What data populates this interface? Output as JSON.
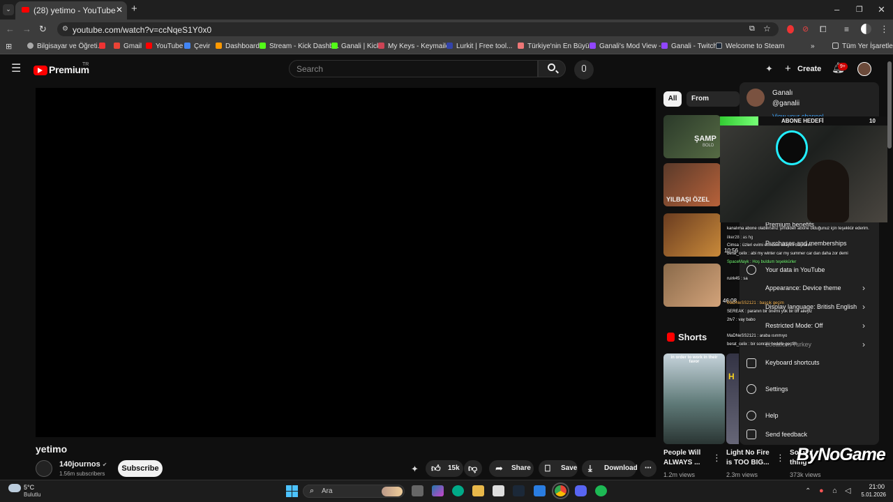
{
  "browser": {
    "tab_title": "(28) yetimo - YouTube",
    "url": "youtube.com/watch?v=ccNqeS1Y0x0",
    "bookmarks": [
      "Bilgisayar ve Öğreti...",
      "Gmail",
      "YouTube",
      "Çevir",
      "Dashboard",
      "Stream - Kick Dashb...",
      "Ganali | Kick",
      "My Keys - Keymailer",
      "Lurkit | Free tool...",
      "Türkiye'nin En Büyü...",
      "Ganali's Mod View -...",
      "Ganali - Twitch",
      "Welcome to Steam"
    ],
    "all_bookmarks": "Tüm Yer İşaretleri"
  },
  "youtube": {
    "logo": "Premium",
    "region": "TR",
    "search_placeholder": "Search",
    "create": "Create",
    "notif_badge": "9+"
  },
  "video": {
    "title": "yetimo",
    "channel": "140journos",
    "subscribers": "1.56m subscribers",
    "subscribe": "Subscribe",
    "likes": "15k",
    "share": "Share",
    "save": "Save",
    "download": "Download"
  },
  "chips": [
    "All",
    "From 140journo"
  ],
  "thumbs": [
    {
      "text": "ŞAMP",
      "sub": "BOLD"
    },
    {
      "text": "YILBAŞI ÖZEL"
    },
    {
      "text": ""
    },
    {
      "text": "46:08"
    }
  ],
  "shorts": {
    "label": "Shorts",
    "thumb1": "in order to work in their favor",
    "items": [
      {
        "title": "People Will ALWAYS ...",
        "views": "1.2m views"
      },
      {
        "title": "Light No Fire is TOO BIG...",
        "views": "2.3m views"
      },
      {
        "title": "So bad thing",
        "views": "373k views"
      }
    ]
  },
  "account": {
    "name": "Ganalı",
    "handle": "@ganalii",
    "view_channel": "View your channel",
    "items": [
      {
        "label": "Premium benefits",
        "chev": false
      },
      {
        "label": "Purchases and memberships",
        "chev": false
      },
      {
        "label": "Your data in YouTube",
        "chev": false
      },
      {
        "label": "Appearance: Device theme",
        "chev": true
      },
      {
        "label": "Display language: British English",
        "chev": true
      },
      {
        "label": "Restricted Mode: Off",
        "chev": true
      },
      {
        "label": "Location: Turkey",
        "chev": true
      },
      {
        "label": "Keyboard shortcuts",
        "chev": false
      },
      {
        "label": "Settings",
        "chev": false
      },
      {
        "label": "Help",
        "chev": false
      },
      {
        "label": "Send feedback",
        "chev": false
      }
    ]
  },
  "overlay": {
    "goal_label": "ABONE HEDEFİ",
    "goal_value": "10",
    "timer": "10:56",
    "watermark": "ByNoGame",
    "chat": [
      "kanalıma abone olabilirsiniz şimdiden abone olduğunuz için teşekkür ederim.",
      "ilker28 : as hg",
      "Cimsa : üzleri evimi elimdeki ailayım başkalım",
      "berat_celix : abi my winter car my summer car dan daha zor demi",
      "SpaceMayk : Hoş buldum teşekkürler",
      "ruirk45 : sa",
      "MaDNeSS2121 : başçık geçim",
      "SEREAK : paranın bir önemi yok bir bir aileyiz",
      "2tv7 : vay babo",
      "MaDNeSS2121 : araba ısınmıyo",
      "berat_celix : bir sonraki hedefe geçtim"
    ]
  },
  "taskbar": {
    "weather_temp": "5°C",
    "weather_desc": "Bulutlu",
    "search": "Ara",
    "time": "21:00",
    "date": "5.01.2026"
  }
}
